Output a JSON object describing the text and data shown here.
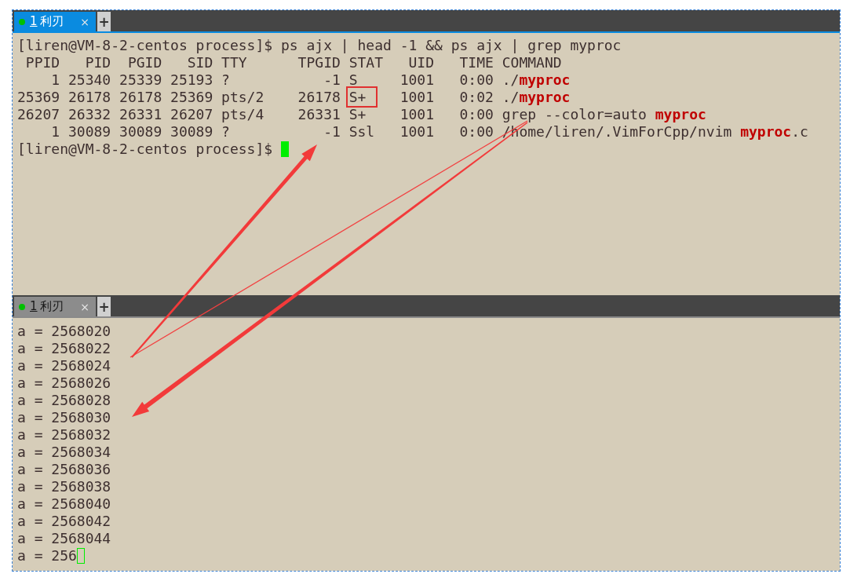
{
  "panes": [
    {
      "active": true,
      "tab": {
        "number": "1",
        "title": "利刃",
        "close": "×",
        "add": "+"
      },
      "lines": [
        [
          {
            "text": "[liren@VM-8-2-centos process]$ ps ajx | head -1 && ps ajx | grep myproc"
          }
        ],
        [
          {
            "text": " PPID   PID  PGID   SID TTY      TPGID STAT   UID   TIME COMMAND"
          }
        ],
        [
          {
            "text": "    1 25340 25339 25193 ?           -1 S     1001   0:00 ./"
          },
          {
            "text": "myproc",
            "match": true
          }
        ],
        [
          {
            "text": "25369 26178 26178 25369 pts/2    26178 "
          },
          {
            "text": "S+",
            "boxed": true
          },
          {
            "text": "    1001   0:02 ./"
          },
          {
            "text": "myproc",
            "match": true
          }
        ],
        [
          {
            "text": "26207 26332 26331 26207 pts/4    26331 S+    1001   0:00 grep --color=auto "
          },
          {
            "text": "myproc",
            "match": true
          }
        ],
        [
          {
            "text": "    1 30089 30089 30089 ?           -1 Ssl   1001   0:00 /home/liren/.VimForCpp/nvim "
          },
          {
            "text": "myproc",
            "match": true
          },
          {
            "text": ".c"
          }
        ],
        [
          {
            "text": "[liren@VM-8-2-centos process]$ ",
            "cursor": true
          }
        ]
      ]
    },
    {
      "active": false,
      "tab": {
        "number": "1",
        "title": "利刃",
        "close": "×",
        "add": "+"
      },
      "lines": [
        [
          {
            "text": "a = 2568020"
          }
        ],
        [
          {
            "text": "a = 2568022"
          }
        ],
        [
          {
            "text": "a = 2568024"
          }
        ],
        [
          {
            "text": "a = 2568026"
          }
        ],
        [
          {
            "text": "a = 2568028"
          }
        ],
        [
          {
            "text": "a = 2568030"
          }
        ],
        [
          {
            "text": "a = 2568032"
          }
        ],
        [
          {
            "text": "a = 2568034"
          }
        ],
        [
          {
            "text": "a = 2568036"
          }
        ],
        [
          {
            "text": "a = 2568038"
          }
        ],
        [
          {
            "text": "a = 2568040"
          }
        ],
        [
          {
            "text": "a = 2568042"
          }
        ],
        [
          {
            "text": "a = 2568044"
          }
        ],
        [
          {
            "text": "a = 256",
            "cursor": true
          }
        ]
      ]
    }
  ]
}
